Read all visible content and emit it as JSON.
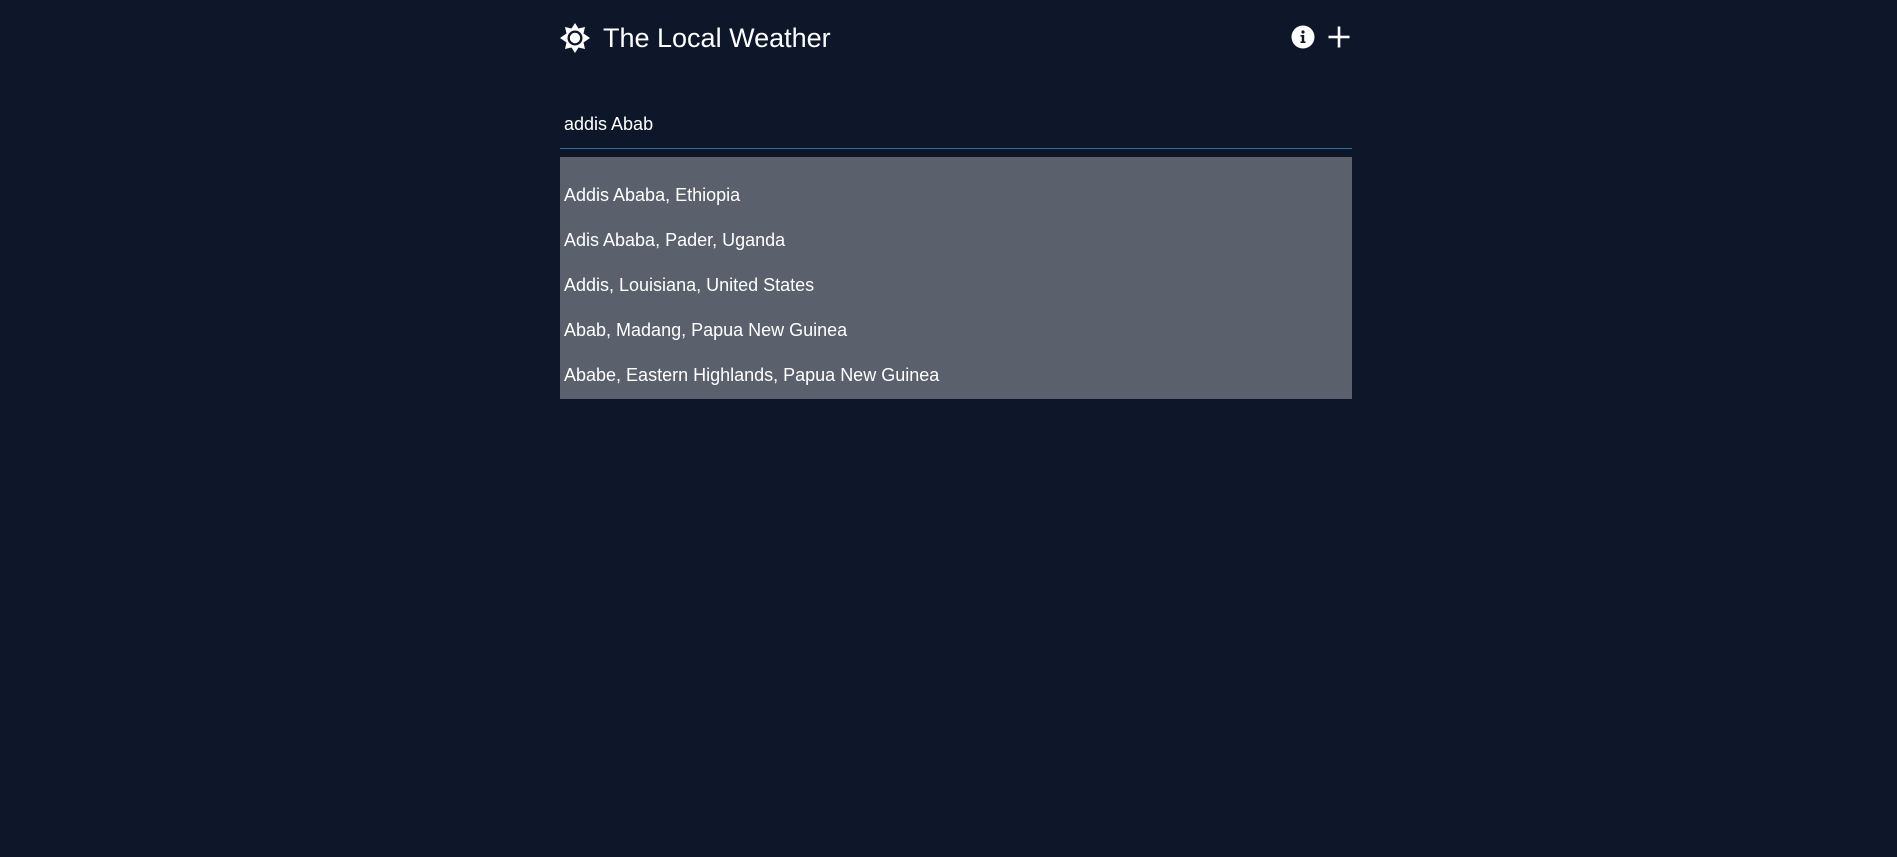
{
  "header": {
    "title": "The Local Weather",
    "brand_icon": "sun-icon",
    "actions": [
      {
        "name": "info-icon"
      },
      {
        "name": "plus-icon"
      }
    ]
  },
  "search": {
    "value": "addis Abab",
    "accent_color": "#2f6f93"
  },
  "suggestions": [
    "Addis Ababa, Ethiopia",
    "Adis Ababa, Pader, Uganda",
    "Addis, Louisiana, United States",
    "Abab, Madang, Papua New Guinea",
    "Ababe, Eastern Highlands, Papua New Guinea"
  ],
  "colors": {
    "background": "#0e1729",
    "dropdown": "#5b606d",
    "text": "#ffffff"
  }
}
